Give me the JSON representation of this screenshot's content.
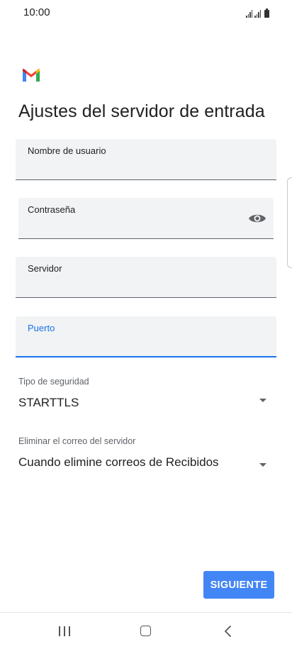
{
  "status_bar": {
    "time": "10:00"
  },
  "app": {
    "logo": "gmail-logo",
    "title": "Ajustes del servidor de entrada"
  },
  "fields": {
    "username": {
      "label": "Nombre de usuario",
      "value": ""
    },
    "password": {
      "label": "Contraseña",
      "value": "",
      "toggle_icon": "eye-icon"
    },
    "server": {
      "label": "Servidor",
      "value": ""
    },
    "port": {
      "label": "Puerto",
      "value": ""
    }
  },
  "selects": {
    "security_type": {
      "label": "Tipo de seguridad",
      "value": "STARTTLS"
    },
    "delete_mail": {
      "label": "Eliminar el correo del servidor",
      "value": "Cuando elimine correos de Recibidos"
    }
  },
  "actions": {
    "next_label": "SIGUIENTE"
  },
  "colors": {
    "accent": "#1a73e8",
    "button": "#4285f4",
    "field_bg": "#f1f3f4"
  }
}
